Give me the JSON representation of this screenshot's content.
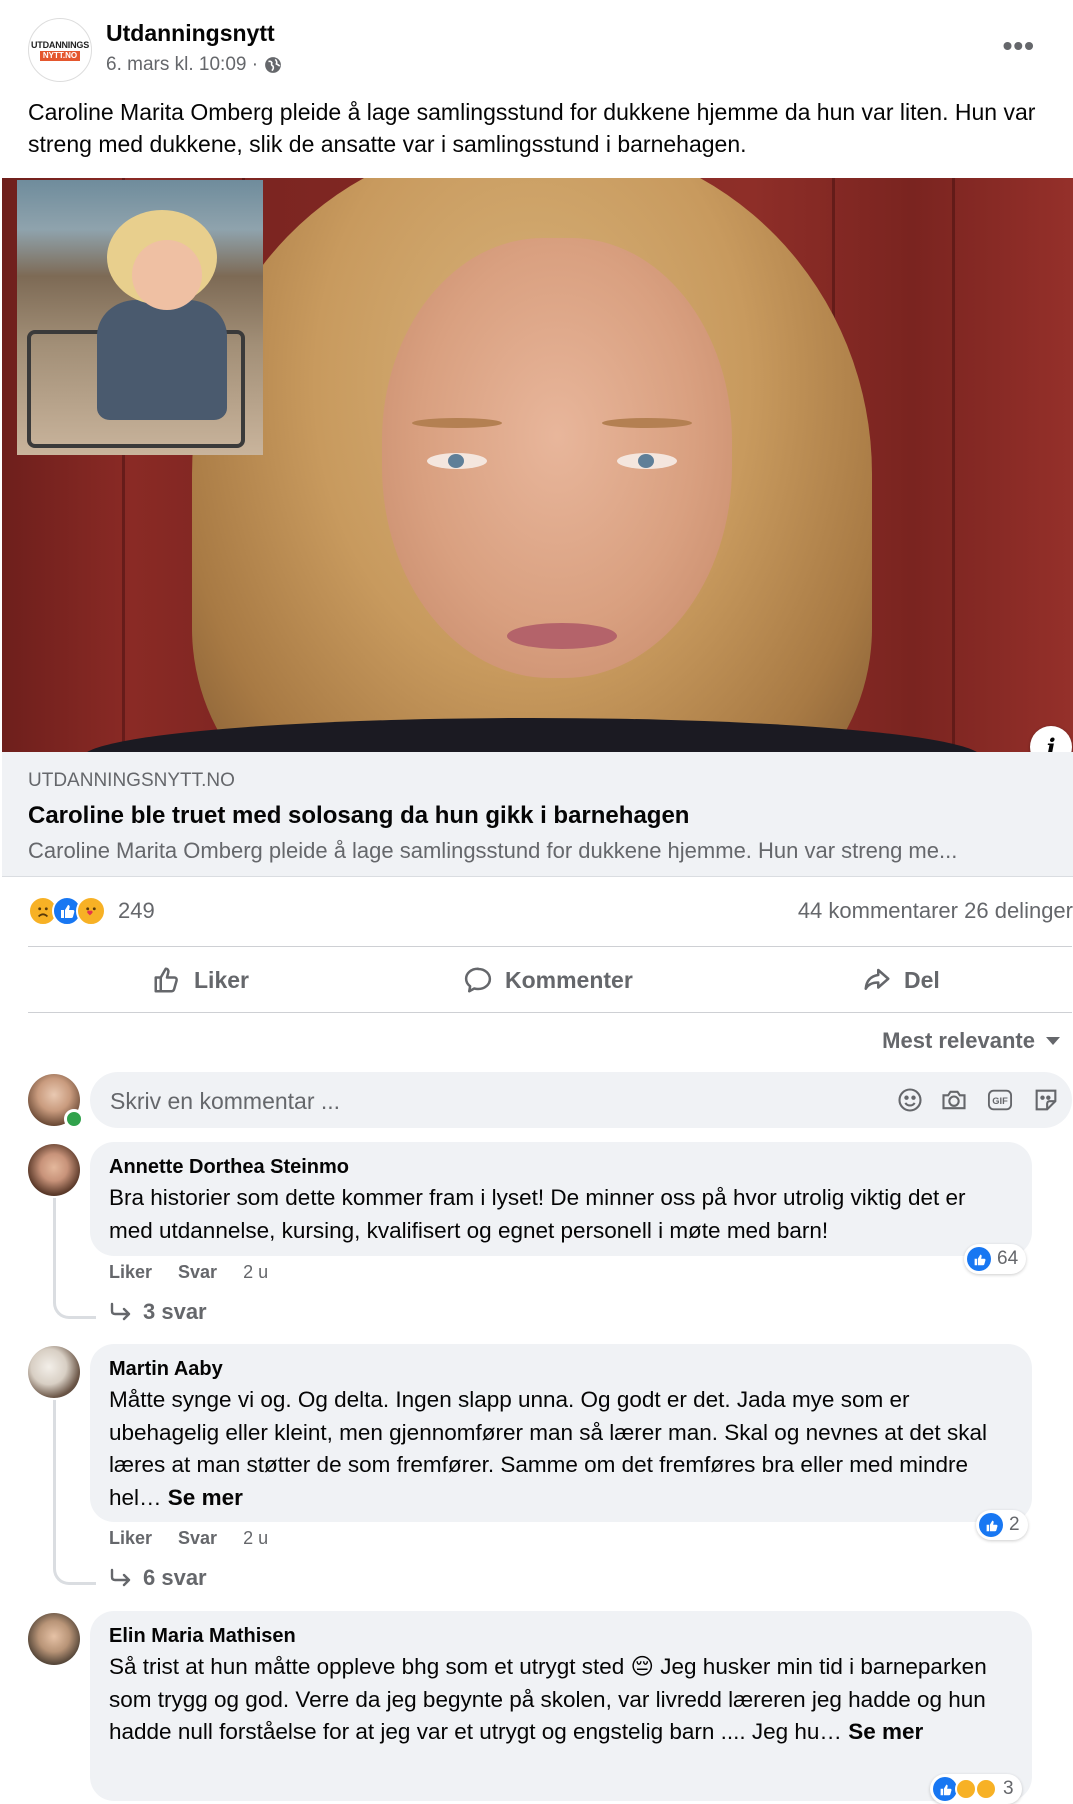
{
  "post": {
    "page_name": "Utdanningsnytt",
    "logo_line1": "UTDANNINGS",
    "logo_line2": "NYTT.NO",
    "timestamp": "6. mars kl. 10:09 ·",
    "text": "Caroline Marita Omberg pleide å lage samlingsstund for dukkene hjemme da hun var liten. Hun var streng med dukkene, slik de ansatte var i samlingsstund i barnehagen."
  },
  "link_preview": {
    "domain": "UTDANNINGSNYTT.NO",
    "title": "Caroline ble truet med solosang da hun gikk i barnehagen",
    "description": "Caroline Marita Omberg pleide å lage samlingsstund for dukkene hjemme. Hun var streng me..."
  },
  "engagement": {
    "reaction_count": "249",
    "comments": "44 kommentarer",
    "shares": "26 delinger",
    "reaction_icons": [
      "sad-reaction",
      "like-reaction",
      "care-reaction"
    ]
  },
  "actions": {
    "like": "Liker",
    "comment": "Kommenter",
    "share": "Del"
  },
  "sort": {
    "label": "Mest relevante"
  },
  "composer": {
    "placeholder": "Skriv en kommentar ...",
    "gif_label": "GIF"
  },
  "comments": [
    {
      "author": "Annette Dorthea Steinmo",
      "text": "Bra historier som dette kommer fram i lyset! De minner oss på hvor utrolig viktig det er med utdannelse, kursing, kvalifisert og egnet personell i møte med barn!",
      "see_more": "",
      "like_label": "Liker",
      "reply_label": "Svar",
      "time": "2 u",
      "reaction_count": "64",
      "replies": "3 svar"
    },
    {
      "author": "Martin Aaby",
      "text": "Måtte synge vi og. Og delta. Ingen slapp unna. Og godt er det. Jada mye som er ubehagelig eller kleint, men gjennomfører man så lærer man. Skal og nevnes at det skal læres at man støtter de som fremfører. Samme om det fremføres bra eller med mindre hel…",
      "see_more": "Se mer",
      "like_label": "Liker",
      "reply_label": "Svar",
      "time": "2 u",
      "reaction_count": "2",
      "replies": "6 svar"
    },
    {
      "author": "Elin Maria Mathisen",
      "text_part1": "Så trist at hun måtte oppleve bhg som et utrygt sted",
      "emoji": "😔",
      "text_part2": "Jeg husker min tid i barneparken som trygg og god. Verre da jeg begynte på skolen, var livredd læreren jeg hadde og hun hadde null forståelse for at jeg var et utrygt og engstelig barn .... Jeg hu…",
      "see_more": "Se mer",
      "reaction_count": "3"
    }
  ],
  "colors": {
    "facebook_blue": "#1877f2",
    "secondary_text": "#65676b",
    "bubble_bg": "#f0f2f5",
    "online_green": "#31a24c"
  }
}
